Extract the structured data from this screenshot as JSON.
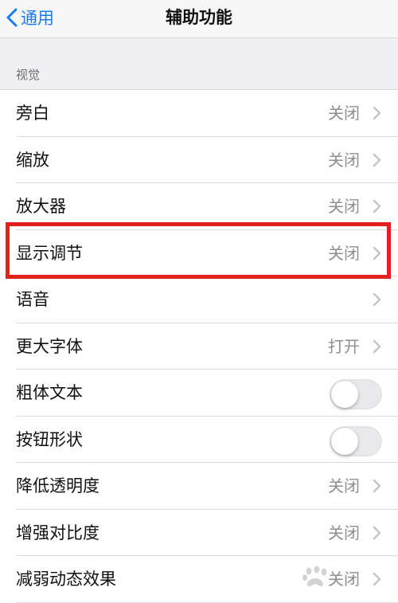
{
  "navbar": {
    "back_label": "通用",
    "title": "辅助功能"
  },
  "section": {
    "label": "视觉"
  },
  "rows": [
    {
      "label": "旁白",
      "value": "关闭",
      "control": "chevron"
    },
    {
      "label": "缩放",
      "value": "关闭",
      "control": "chevron"
    },
    {
      "label": "放大器",
      "value": "关闭",
      "control": "chevron"
    },
    {
      "label": "显示调节",
      "value": "关闭",
      "control": "chevron",
      "highlighted": true
    },
    {
      "label": "语音",
      "value": "",
      "control": "chevron"
    },
    {
      "label": "更大字体",
      "value": "打开",
      "control": "chevron"
    },
    {
      "label": "粗体文本",
      "value": "",
      "control": "toggle",
      "on": false
    },
    {
      "label": "按钮形状",
      "value": "",
      "control": "toggle",
      "on": false
    },
    {
      "label": "降低透明度",
      "value": "关闭",
      "control": "chevron"
    },
    {
      "label": "增强对比度",
      "value": "关闭",
      "control": "chevron"
    },
    {
      "label": "减弱动态效果",
      "value": "关闭",
      "control": "chevron"
    }
  ],
  "colors": {
    "accent": "#1a7cf5",
    "highlight_box": "#e2211c",
    "secondary_text": "#8e8e93",
    "group_background": "#efeff4"
  },
  "icons": {
    "back": "chevron-left-icon",
    "disclosure": "chevron-right-icon",
    "watermark": "baidu-paw-icon"
  }
}
